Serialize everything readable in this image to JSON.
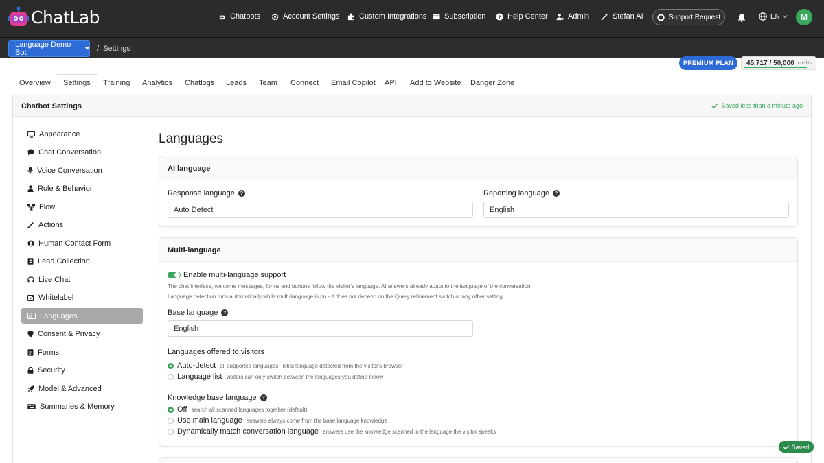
{
  "brand": {
    "name": "ChatLab"
  },
  "nav": [
    {
      "label": "Chatbots",
      "icon": "robot-icon"
    },
    {
      "label": "Account Settings",
      "icon": "gear-icon"
    },
    {
      "label": "Custom Integrations",
      "icon": "puzzle-icon"
    },
    {
      "label": "Subscription",
      "icon": "card-icon"
    },
    {
      "label": "Help Center",
      "icon": "question-icon"
    },
    {
      "label": "Admin",
      "icon": "user-gear-icon"
    },
    {
      "label": "Stefan AI",
      "icon": "magic-wand-icon"
    }
  ],
  "support": {
    "label": "Support Request"
  },
  "language": {
    "code": "EN"
  },
  "user": {
    "initial": "M"
  },
  "breadcrumb": {
    "bot": "Language Demo Bot",
    "page": "Settings"
  },
  "plan": {
    "label": "PREMIUM PLAN",
    "credits_used": "45,717",
    "credits_total": "/ 50,000",
    "credits_label": "credits",
    "credits_fraction": 0.914
  },
  "tabs": [
    "Overview",
    "Settings",
    "Training",
    "Analytics",
    "Chatlogs",
    "Leads",
    "Team",
    "Connect",
    "Email Copilot",
    "API",
    "Add to Website",
    "Danger Zone"
  ],
  "active_tab": "Settings",
  "panel": {
    "title": "Chatbot Settings",
    "saved_status": "Saved less than a minute ago"
  },
  "sidebar": [
    {
      "label": "Appearance",
      "icon": "monitor-icon"
    },
    {
      "label": "Chat Conversation",
      "icon": "speech-bubble-icon"
    },
    {
      "label": "Voice Conversation",
      "icon": "microphone-icon"
    },
    {
      "label": "Role & Behavior",
      "icon": "person-icon"
    },
    {
      "label": "Flow",
      "icon": "flow-icon"
    },
    {
      "label": "Actions",
      "icon": "magic-wand-icon"
    },
    {
      "label": "Human Contact Form",
      "icon": "user-circle-icon"
    },
    {
      "label": "Lead Collection",
      "icon": "address-book-icon"
    },
    {
      "label": "Live Chat",
      "icon": "headset-icon"
    },
    {
      "label": "Whitelabel",
      "icon": "edit-icon"
    },
    {
      "label": "Languages",
      "icon": "language-icon"
    },
    {
      "label": "Consent & Privacy",
      "icon": "shield-icon"
    },
    {
      "label": "Forms",
      "icon": "forms-icon"
    },
    {
      "label": "Security",
      "icon": "lock-icon"
    },
    {
      "label": "Model & Advanced",
      "icon": "rocket-icon"
    },
    {
      "label": "Summaries & Memory",
      "icon": "keyboard-icon"
    }
  ],
  "active_section": "Languages",
  "page_title": "Languages",
  "ai_language": {
    "title": "AI language",
    "response_label": "Response language",
    "response_value": "Auto Detect",
    "reporting_label": "Reporting language",
    "reporting_value": "English"
  },
  "multi_language": {
    "title": "Multi-language",
    "toggle_label": "Enable multi-language support",
    "toggle_on": true,
    "desc1": "The chat interface, welcome messages, forms and buttons follow the visitor's language. AI answers already adapt to the language of the conversation.",
    "desc2": "Language detection runs automatically while multi-language is on - it does not depend on the Query refinement switch or any other setting.",
    "base_label": "Base language",
    "base_value": "English",
    "offered_label": "Languages offered to visitors",
    "offered_options": [
      {
        "label": "Auto-detect",
        "desc": "all supported languages, initial language detected from the visitor's browser",
        "selected": true
      },
      {
        "label": "Language list",
        "desc": "visitors can only switch between the languages you define below",
        "selected": false
      }
    ],
    "kb_label": "Knowledge base language",
    "kb_options": [
      {
        "label": "Off",
        "desc": "search all scanned languages together (default)",
        "selected": true
      },
      {
        "label": "Use main language",
        "desc": "answers always come from the base language knowledge",
        "selected": false
      },
      {
        "label": "Dynamically match conversation language",
        "desc": "answers use the knowledge scanned in the language the visitor speaks",
        "selected": false
      }
    ]
  },
  "toast": {
    "label": "Saved"
  },
  "colors": {
    "accent": "#2d6cd6",
    "success": "#3aa85d",
    "topbar": "#2b2b2b"
  }
}
